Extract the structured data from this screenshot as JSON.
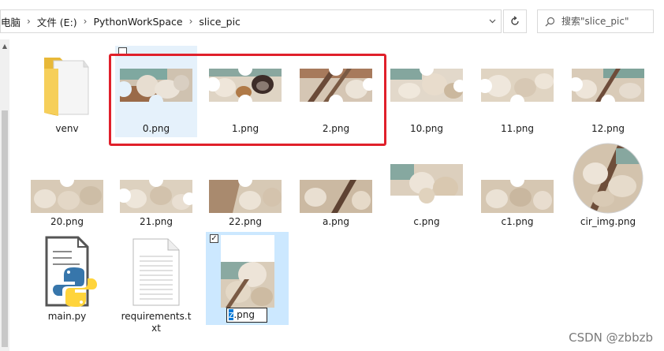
{
  "breadcrumb": [
    "电脑",
    "文件 (E:)",
    "PythonWorkSpace",
    "slice_pic"
  ],
  "search": {
    "placeholder": "搜索\"slice_pic\""
  },
  "files": [
    {
      "name": "venv",
      "kind": "folder"
    },
    {
      "name": "0.png",
      "kind": "image"
    },
    {
      "name": "1.png",
      "kind": "image"
    },
    {
      "name": "2.png",
      "kind": "image"
    },
    {
      "name": "10.png",
      "kind": "image"
    },
    {
      "name": "11.png",
      "kind": "image"
    },
    {
      "name": "12.png",
      "kind": "image"
    },
    {
      "name": "20.png",
      "kind": "image"
    },
    {
      "name": "21.png",
      "kind": "image"
    },
    {
      "name": "22.png",
      "kind": "image"
    },
    {
      "name": "a.png",
      "kind": "image"
    },
    {
      "name": "c.png",
      "kind": "image"
    },
    {
      "name": "c1.png",
      "kind": "image"
    },
    {
      "name": "cir_img.png",
      "kind": "image"
    },
    {
      "name": "main.py",
      "kind": "python"
    },
    {
      "name": "requirements.txt",
      "kind": "text"
    },
    {
      "name": "z.png",
      "kind": "image"
    }
  ],
  "rename": {
    "selected": "z",
    "rest": ".png"
  },
  "highlighted_files": [
    "0.png",
    "1.png",
    "2.png"
  ],
  "watermark": "CSDN @zbbzb",
  "colors": {
    "highlight": "#e0202b",
    "selection": "#cce8ff",
    "hover": "#e5f1fb",
    "accent": "#0078d7"
  }
}
